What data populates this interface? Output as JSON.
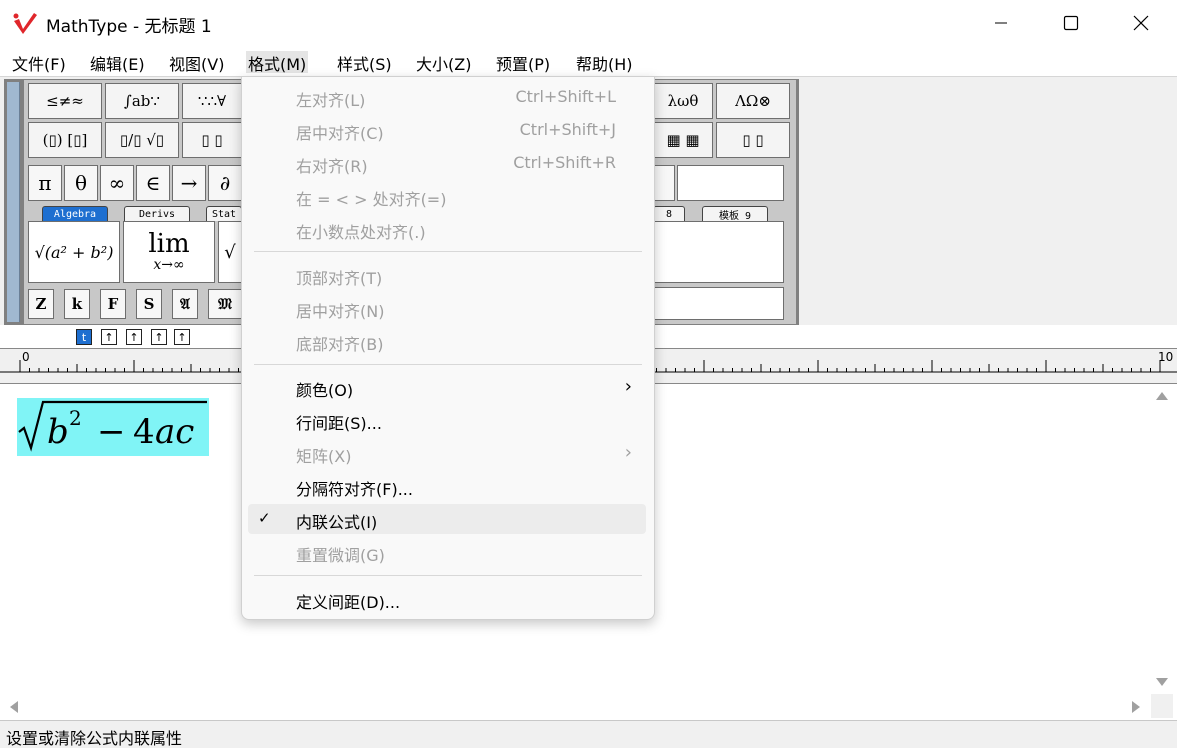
{
  "window": {
    "title": "MathType - 无标题 1",
    "controls": {
      "minimize": "minimize-icon",
      "maximize": "maximize-icon",
      "close": "close-icon"
    }
  },
  "menubar": {
    "items": [
      "文件(F)",
      "编辑(E)",
      "视图(V)",
      "格式(M)",
      "样式(S)",
      "大小(Z)",
      "预置(P)",
      "帮助(H)"
    ],
    "active": "格式(M)"
  },
  "palette": {
    "row1": [
      "≤≠≈",
      "∫ab∵",
      "∵∴∀",
      "λωθ",
      "ΛΩ⊗"
    ],
    "row2": [
      "(▯) [▯]",
      "▯/▯ √▯",
      "▯ ▯",
      "▦ ▦",
      "▯ ▯"
    ],
    "symbols": [
      "π",
      "θ",
      "∞",
      "∈",
      "→",
      "∂"
    ],
    "tabs": [
      "Algebra",
      "Derivs",
      "Stat",
      "8",
      "模板 9"
    ],
    "templates": {
      "sqrt": "√(a² + b²)",
      "lim": "lim",
      "lim_sub": "x→∞"
    },
    "small_symbols": [
      "Z",
      "k",
      "F",
      "S",
      "𝔄",
      "𝔐"
    ],
    "nudge": [
      "t",
      "↑",
      "↑",
      "↑",
      "↑"
    ]
  },
  "ruler": {
    "start_label": "0",
    "end_label": "10"
  },
  "editor": {
    "formula": {
      "radicand_b": "b",
      "exponent": "2",
      "minus": "−",
      "coef": "4",
      "vars": "ac"
    }
  },
  "dropdown": {
    "items": [
      {
        "label": "左对齐(L)",
        "shortcut": "Ctrl+Shift+L",
        "enabled": false
      },
      {
        "label": "居中对齐(C)",
        "shortcut": "Ctrl+Shift+J",
        "enabled": false
      },
      {
        "label": "右对齐(R)",
        "shortcut": "Ctrl+Shift+R",
        "enabled": false
      },
      {
        "label": "在 = < > 处对齐(=)",
        "shortcut": "",
        "enabled": false
      },
      {
        "label": "在小数点处对齐(.)",
        "shortcut": "",
        "enabled": false
      },
      {
        "label": "顶部对齐(T)",
        "shortcut": "",
        "enabled": false
      },
      {
        "label": "居中对齐(N)",
        "shortcut": "",
        "enabled": false
      },
      {
        "label": "底部对齐(B)",
        "shortcut": "",
        "enabled": false
      },
      {
        "label": "颜色(O)",
        "submenu": true,
        "enabled": true
      },
      {
        "label": "行间距(S)...",
        "enabled": true
      },
      {
        "label": "矩阵(X)",
        "submenu": true,
        "enabled": false
      },
      {
        "label": "分隔符对齐(F)...",
        "enabled": true
      },
      {
        "label": "内联公式(I)",
        "checked": true,
        "enabled": true
      },
      {
        "label": "重置微调(G)",
        "enabled": false
      },
      {
        "label": "定义间距(D)...",
        "enabled": true
      }
    ],
    "check_mark": "✓",
    "submenu_arrow": "›"
  },
  "status": {
    "text": "设置或清除公式内联属性"
  }
}
